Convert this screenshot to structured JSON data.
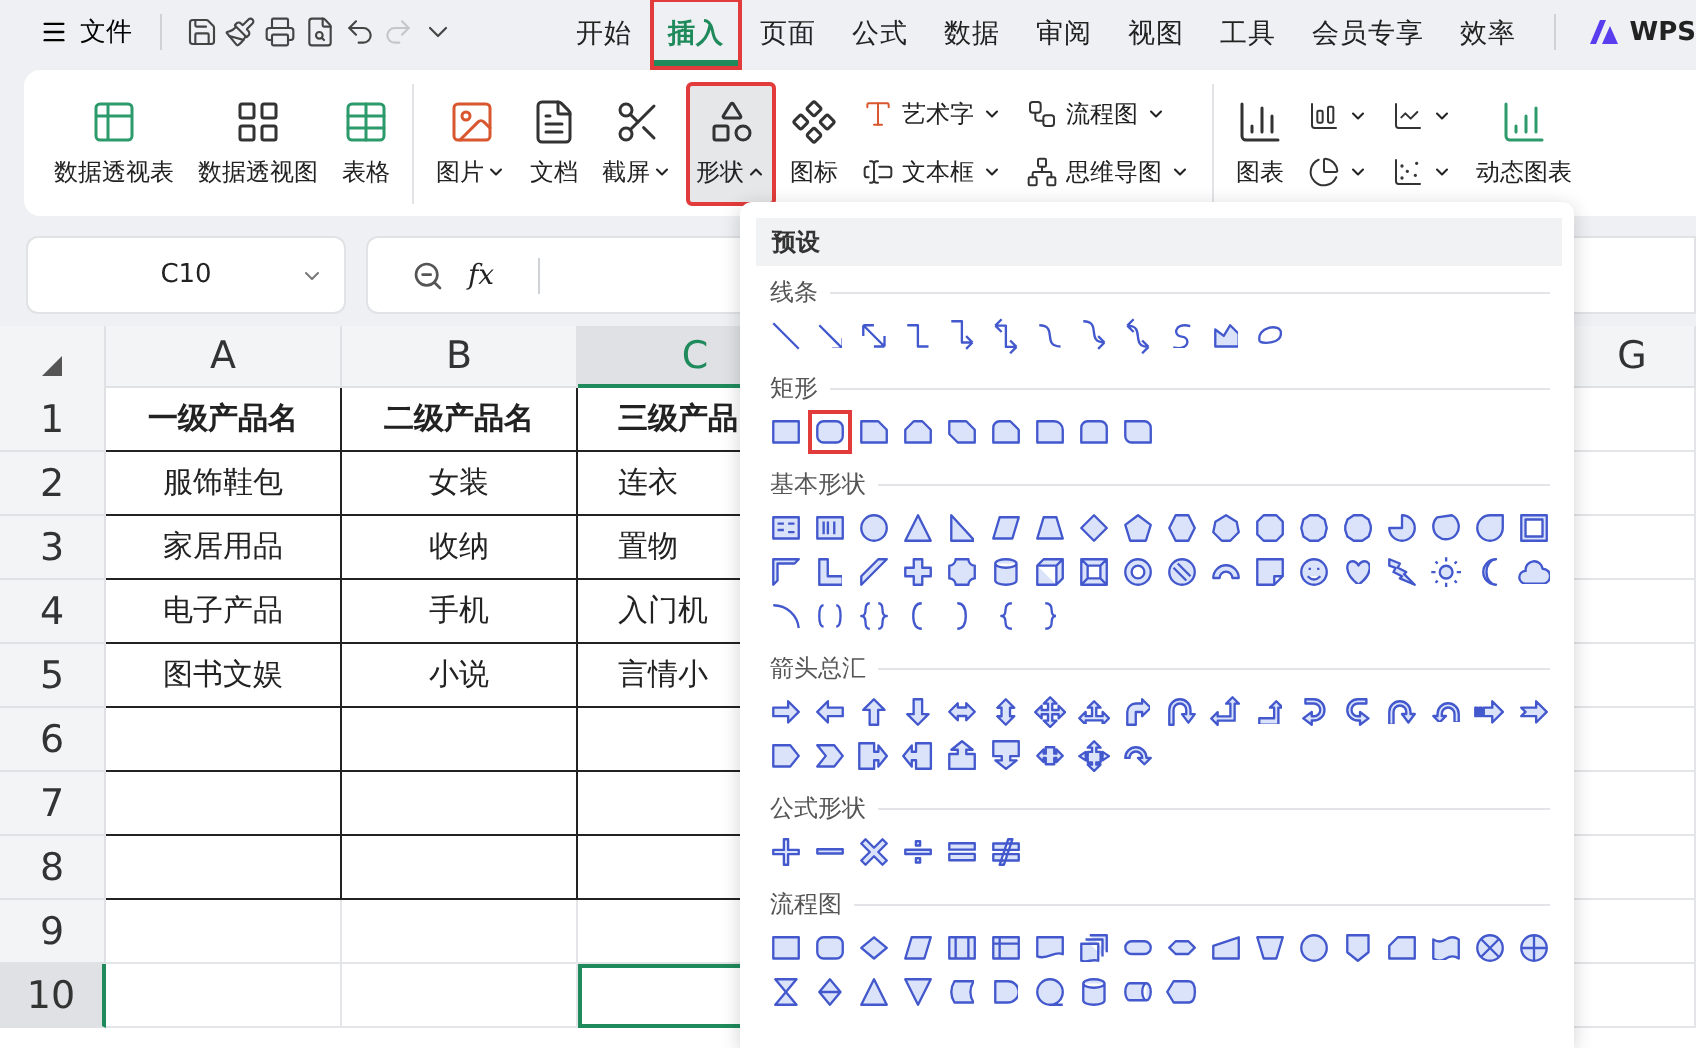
{
  "top_bar": {
    "file_menu": {
      "label": "文件"
    },
    "quick_access": [
      {
        "disabled": false
      },
      {
        "disabled": false
      },
      {
        "disabled": false
      },
      {
        "disabled": false
      },
      {
        "disabled": false
      },
      {
        "disabled": true
      },
      {
        "disabled": false
      }
    ],
    "tabs": [
      {
        "label": "开始",
        "selected": false,
        "annotated": false
      },
      {
        "label": "插入",
        "selected": true,
        "annotated": true
      },
      {
        "label": "页面",
        "selected": false,
        "annotated": false
      },
      {
        "label": "公式",
        "selected": false,
        "annotated": false
      },
      {
        "label": "数据",
        "selected": false,
        "annotated": false
      },
      {
        "label": "审阅",
        "selected": false,
        "annotated": false
      },
      {
        "label": "视图",
        "selected": false,
        "annotated": false
      },
      {
        "label": "工具",
        "selected": false,
        "annotated": false
      },
      {
        "label": "会员专享",
        "selected": false,
        "annotated": false
      },
      {
        "label": "效率",
        "selected": false,
        "annotated": false
      }
    ],
    "brand": "WPS"
  },
  "ribbon": {
    "groups": [
      {
        "columns": [
          [
            {
              "kind": "large",
              "label": "数据透视表",
              "dropdown": false,
              "expanded": false,
              "annotated": false
            }
          ],
          [
            {
              "kind": "large",
              "label": "数据透视图",
              "dropdown": false,
              "expanded": false,
              "annotated": false
            }
          ],
          [
            {
              "kind": "large",
              "label": "表格",
              "dropdown": false,
              "expanded": false,
              "annotated": false
            }
          ]
        ]
      },
      {
        "columns": [
          [
            {
              "kind": "large",
              "label": "图片",
              "dropdown": true,
              "expanded": false,
              "annotated": false
            }
          ],
          [
            {
              "kind": "large",
              "label": "文档",
              "dropdown": false,
              "expanded": false,
              "annotated": false
            }
          ],
          [
            {
              "kind": "large",
              "label": "截屏",
              "dropdown": true,
              "expanded": false,
              "annotated": false
            }
          ],
          [
            {
              "kind": "large",
              "label": "形状",
              "dropdown": true,
              "expanded": true,
              "annotated": true
            }
          ],
          [
            {
              "kind": "large",
              "label": "图标",
              "dropdown": false,
              "expanded": false,
              "annotated": false
            }
          ],
          [
            {
              "kind": "small",
              "label": "艺术字",
              "dropdown": true,
              "expanded": false,
              "annotated": false
            },
            {
              "kind": "small",
              "label": "文本框",
              "dropdown": true,
              "expanded": false,
              "annotated": false
            }
          ],
          [
            {
              "kind": "small",
              "label": "流程图",
              "dropdown": true,
              "expanded": false,
              "annotated": false
            },
            {
              "kind": "small",
              "label": "思维导图",
              "dropdown": true,
              "expanded": false,
              "annotated": false
            }
          ]
        ]
      },
      {
        "columns": [
          [
            {
              "kind": "large",
              "label": "图表",
              "dropdown": false,
              "expanded": false,
              "annotated": false
            }
          ],
          [
            {
              "kind": "icon",
              "dropdown": true,
              "expanded": false,
              "annotated": false
            },
            {
              "kind": "icon",
              "dropdown": true,
              "expanded": false,
              "annotated": false
            }
          ],
          [
            {
              "kind": "icon",
              "dropdown": true,
              "expanded": false,
              "annotated": false
            },
            {
              "kind": "icon",
              "dropdown": true,
              "expanded": false,
              "annotated": false
            }
          ],
          [
            {
              "kind": "large",
              "label": "动态图表",
              "dropdown": false,
              "expanded": false,
              "annotated": false
            }
          ]
        ]
      }
    ]
  },
  "formula_bar": {
    "name_box": "C10",
    "fx_label": "fx"
  },
  "sheet": {
    "columns": [
      {
        "label": "A",
        "selected": false
      },
      {
        "label": "B",
        "selected": false
      },
      {
        "label": "C",
        "selected": true
      },
      {
        "label": "G",
        "selected": false
      }
    ],
    "rows": [
      {
        "label": "1",
        "kind": "header",
        "selected": false,
        "cells": [
          "一级产品名",
          "二级产品名",
          "三级产品"
        ]
      },
      {
        "label": "2",
        "kind": "data",
        "selected": false,
        "cells": [
          "服饰鞋包",
          "女装",
          "连衣"
        ]
      },
      {
        "label": "3",
        "kind": "data",
        "selected": false,
        "cells": [
          "家居用品",
          "收纳",
          "置物"
        ]
      },
      {
        "label": "4",
        "kind": "data",
        "selected": false,
        "cells": [
          "电子产品",
          "手机",
          "入门机"
        ]
      },
      {
        "label": "5",
        "kind": "data",
        "selected": false,
        "cells": [
          "图书文娱",
          "小说",
          "言情小"
        ]
      },
      {
        "label": "6",
        "kind": "data",
        "selected": false,
        "cells": []
      },
      {
        "label": "7",
        "kind": "data",
        "selected": false,
        "cells": []
      },
      {
        "label": "8",
        "kind": "data",
        "selected": false,
        "cells": []
      },
      {
        "label": "9",
        "kind": "blank",
        "selected": false,
        "cells": []
      },
      {
        "label": "10",
        "kind": "blank",
        "selected": true,
        "cells": []
      }
    ]
  },
  "shape_menu": {
    "header": "预设",
    "sections": [
      {
        "title": "线条",
        "shapes": [
          {
            "kind": "line",
            "annotated": false
          },
          {
            "kind": "arrow",
            "annotated": false
          },
          {
            "kind": "double-arrow",
            "annotated": false
          },
          {
            "kind": "elbow",
            "annotated": false
          },
          {
            "kind": "elbow-arrow",
            "annotated": false
          },
          {
            "kind": "elbow-double-arrow",
            "annotated": false
          },
          {
            "kind": "curve",
            "annotated": false
          },
          {
            "kind": "curve-arrow",
            "annotated": false
          },
          {
            "kind": "curve-double-arrow",
            "annotated": false
          },
          {
            "kind": "s-curve",
            "annotated": false
          },
          {
            "kind": "freeform",
            "annotated": false
          },
          {
            "kind": "scribble",
            "annotated": false
          }
        ]
      },
      {
        "title": "矩形",
        "shapes": [
          {
            "kind": "rect",
            "annotated": false
          },
          {
            "kind": "rounded-rect",
            "annotated": true
          },
          {
            "kind": "snip-corner",
            "annotated": false
          },
          {
            "kind": "snip-two-corners",
            "annotated": false
          },
          {
            "kind": "snip-diagonal",
            "annotated": false
          },
          {
            "kind": "snip-round",
            "annotated": false
          },
          {
            "kind": "round-corner",
            "annotated": false
          },
          {
            "kind": "round-two-corners",
            "annotated": false
          },
          {
            "kind": "round-diagonal",
            "annotated": false
          }
        ]
      },
      {
        "title": "基本形状",
        "shapes": [
          {
            "kind": "text-box",
            "annotated": false
          },
          {
            "kind": "vertical-text-box",
            "annotated": false
          },
          {
            "kind": "oval",
            "annotated": false
          },
          {
            "kind": "triangle",
            "annotated": false
          },
          {
            "kind": "right-triangle",
            "annotated": false
          },
          {
            "kind": "parallelogram",
            "annotated": false
          },
          {
            "kind": "trapezoid",
            "annotated": false
          },
          {
            "kind": "diamond",
            "annotated": false
          },
          {
            "kind": "pentagon",
            "annotated": false
          },
          {
            "kind": "hexagon",
            "annotated": false
          },
          {
            "kind": "heptagon",
            "annotated": false
          },
          {
            "kind": "octagon",
            "annotated": false
          },
          {
            "kind": "decagon",
            "annotated": false
          },
          {
            "kind": "dodecagon",
            "annotated": false
          },
          {
            "kind": "pie",
            "annotated": false
          },
          {
            "kind": "chord",
            "annotated": false
          },
          {
            "kind": "teardrop",
            "annotated": false
          },
          {
            "kind": "frame",
            "annotated": false
          },
          {
            "kind": "half-frame",
            "annotated": false
          },
          {
            "kind": "l-shape",
            "annotated": false
          },
          {
            "kind": "diagonal-stripe",
            "annotated": false
          },
          {
            "kind": "cross",
            "annotated": false
          },
          {
            "kind": "plaque",
            "annotated": false
          },
          {
            "kind": "can",
            "annotated": false
          },
          {
            "kind": "cube",
            "annotated": false
          },
          {
            "kind": "bevel",
            "annotated": false
          },
          {
            "kind": "donut",
            "annotated": false
          },
          {
            "kind": "no-symbol",
            "annotated": false
          },
          {
            "kind": "block-arc",
            "annotated": false
          },
          {
            "kind": "folded-corner",
            "annotated": false
          },
          {
            "kind": "smiley",
            "annotated": false
          },
          {
            "kind": "heart",
            "annotated": false
          },
          {
            "kind": "lightning",
            "annotated": false
          },
          {
            "kind": "sun",
            "annotated": false
          },
          {
            "kind": "moon",
            "annotated": false
          },
          {
            "kind": "cloud",
            "annotated": false
          },
          {
            "kind": "arc",
            "annotated": false
          },
          {
            "kind": "double-bracket",
            "annotated": false
          },
          {
            "kind": "double-brace",
            "annotated": false
          },
          {
            "kind": "left-bracket",
            "annotated": false
          },
          {
            "kind": "right-bracket",
            "annotated": false
          },
          {
            "kind": "left-brace",
            "annotated": false
          },
          {
            "kind": "right-brace",
            "annotated": false
          }
        ]
      },
      {
        "title": "箭头总汇",
        "shapes": [
          {
            "kind": "right-arrow",
            "annotated": false
          },
          {
            "kind": "left-arrow",
            "annotated": false
          },
          {
            "kind": "up-arrow",
            "annotated": false
          },
          {
            "kind": "down-arrow",
            "annotated": false
          },
          {
            "kind": "left-right-arrow",
            "annotated": false
          },
          {
            "kind": "up-down-arrow",
            "annotated": false
          },
          {
            "kind": "quad-arrow",
            "annotated": false
          },
          {
            "kind": "left-right-up-arrow",
            "annotated": false
          },
          {
            "kind": "bent-arrow",
            "annotated": false
          },
          {
            "kind": "u-turn-arrow",
            "annotated": false
          },
          {
            "kind": "left-up-arrow",
            "annotated": false
          },
          {
            "kind": "bent-up-arrow",
            "annotated": false
          },
          {
            "kind": "curved-right-arrow",
            "annotated": false
          },
          {
            "kind": "curved-left-arrow",
            "annotated": false
          },
          {
            "kind": "curved-up-arrow",
            "annotated": false
          },
          {
            "kind": "curved-down-arrow",
            "annotated": false
          },
          {
            "kind": "striped-right-arrow",
            "annotated": false
          },
          {
            "kind": "notched-right-arrow",
            "annotated": false
          },
          {
            "kind": "home-plate",
            "annotated": false
          },
          {
            "kind": "chevron",
            "annotated": false
          },
          {
            "kind": "right-arrow-callout",
            "annotated": false
          },
          {
            "kind": "left-arrow-callout",
            "annotated": false
          },
          {
            "kind": "up-arrow-callout",
            "annotated": false
          },
          {
            "kind": "down-arrow-callout",
            "annotated": false
          },
          {
            "kind": "left-right-arrow-callout",
            "annotated": false
          },
          {
            "kind": "quad-arrow-callout",
            "annotated": false
          },
          {
            "kind": "circular-arrow",
            "annotated": false
          }
        ]
      },
      {
        "title": "公式形状",
        "shapes": [
          {
            "kind": "plus",
            "annotated": false
          },
          {
            "kind": "minus",
            "annotated": false
          },
          {
            "kind": "multiply",
            "annotated": false
          },
          {
            "kind": "divide",
            "annotated": false
          },
          {
            "kind": "equal",
            "annotated": false
          },
          {
            "kind": "not-equal",
            "annotated": false
          }
        ]
      },
      {
        "title": "流程图",
        "shapes": [
          {
            "kind": "process",
            "annotated": false
          },
          {
            "kind": "alternate-process",
            "annotated": false
          },
          {
            "kind": "decision",
            "annotated": false
          },
          {
            "kind": "data",
            "annotated": false
          },
          {
            "kind": "predefined-process",
            "annotated": false
          },
          {
            "kind": "internal-storage",
            "annotated": false
          },
          {
            "kind": "document",
            "annotated": false
          },
          {
            "kind": "multidocument",
            "annotated": false
          },
          {
            "kind": "terminator",
            "annotated": false
          },
          {
            "kind": "preparation",
            "annotated": false
          },
          {
            "kind": "manual-input",
            "annotated": false
          },
          {
            "kind": "manual-operation",
            "annotated": false
          },
          {
            "kind": "connector",
            "annotated": false
          },
          {
            "kind": "off-page-connector",
            "annotated": false
          },
          {
            "kind": "card",
            "annotated": false
          },
          {
            "kind": "punched-tape",
            "annotated": false
          },
          {
            "kind": "summing-junction",
            "annotated": false
          },
          {
            "kind": "or",
            "annotated": false
          },
          {
            "kind": "collate",
            "annotated": false
          },
          {
            "kind": "sort",
            "annotated": false
          },
          {
            "kind": "extract",
            "annotated": false
          },
          {
            "kind": "merge",
            "annotated": false
          },
          {
            "kind": "stored-data",
            "annotated": false
          },
          {
            "kind": "delay",
            "annotated": false
          },
          {
            "kind": "sequential-access",
            "annotated": false
          },
          {
            "kind": "magnetic-disk",
            "annotated": false
          },
          {
            "kind": "direct-access",
            "annotated": false
          },
          {
            "kind": "display",
            "annotated": false
          }
        ]
      }
    ]
  }
}
